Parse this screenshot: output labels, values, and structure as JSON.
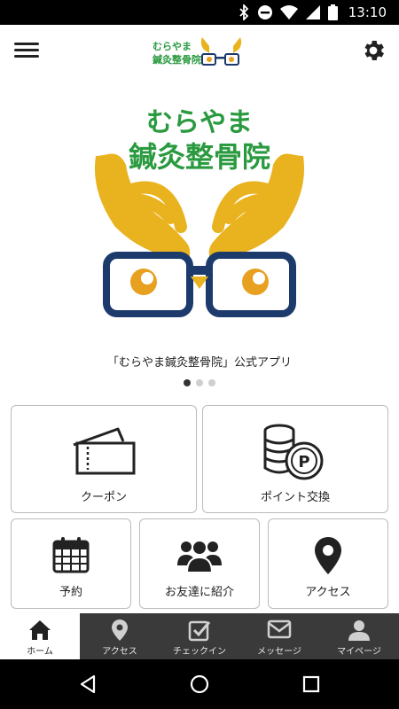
{
  "status_bar": {
    "time": "13:10",
    "icons": [
      "bluetooth-icon",
      "do-not-disturb-icon",
      "wifi-icon",
      "signal-icon",
      "battery-icon"
    ]
  },
  "header": {
    "logo_text_line1": "むらやま",
    "logo_text_line2": "鍼灸整骨院"
  },
  "hero": {
    "logo_line1": "むらやま",
    "logo_line2": "鍼灸整骨院",
    "caption": "「むらやま鍼灸整骨院」公式アプリ",
    "slides": 3,
    "active_slide": 1
  },
  "tiles": [
    {
      "label": "クーポン",
      "icon": "ticket-icon"
    },
    {
      "label": "ポイント交換",
      "icon": "point-coins-icon"
    },
    {
      "label": "予約",
      "icon": "calendar-icon"
    },
    {
      "label": "お友達に紹介",
      "icon": "group-icon"
    },
    {
      "label": "アクセス",
      "icon": "location-pin-icon"
    }
  ],
  "bottom_nav": [
    {
      "label": "ホーム",
      "icon": "home-icon",
      "active": true
    },
    {
      "label": "アクセス",
      "icon": "location-pin-icon",
      "active": false
    },
    {
      "label": "チェックイン",
      "icon": "checkbox-icon",
      "active": false
    },
    {
      "label": "メッセージ",
      "icon": "mail-icon",
      "active": false
    },
    {
      "label": "マイページ",
      "icon": "person-icon",
      "active": false
    }
  ],
  "colors": {
    "brand_green": "#2a9a3f",
    "hand_yellow": "#e8b31f",
    "glasses_navy": "#1c3a6b",
    "eye_orange": "#e8a020",
    "nav_bg": "#3a3a3a"
  }
}
